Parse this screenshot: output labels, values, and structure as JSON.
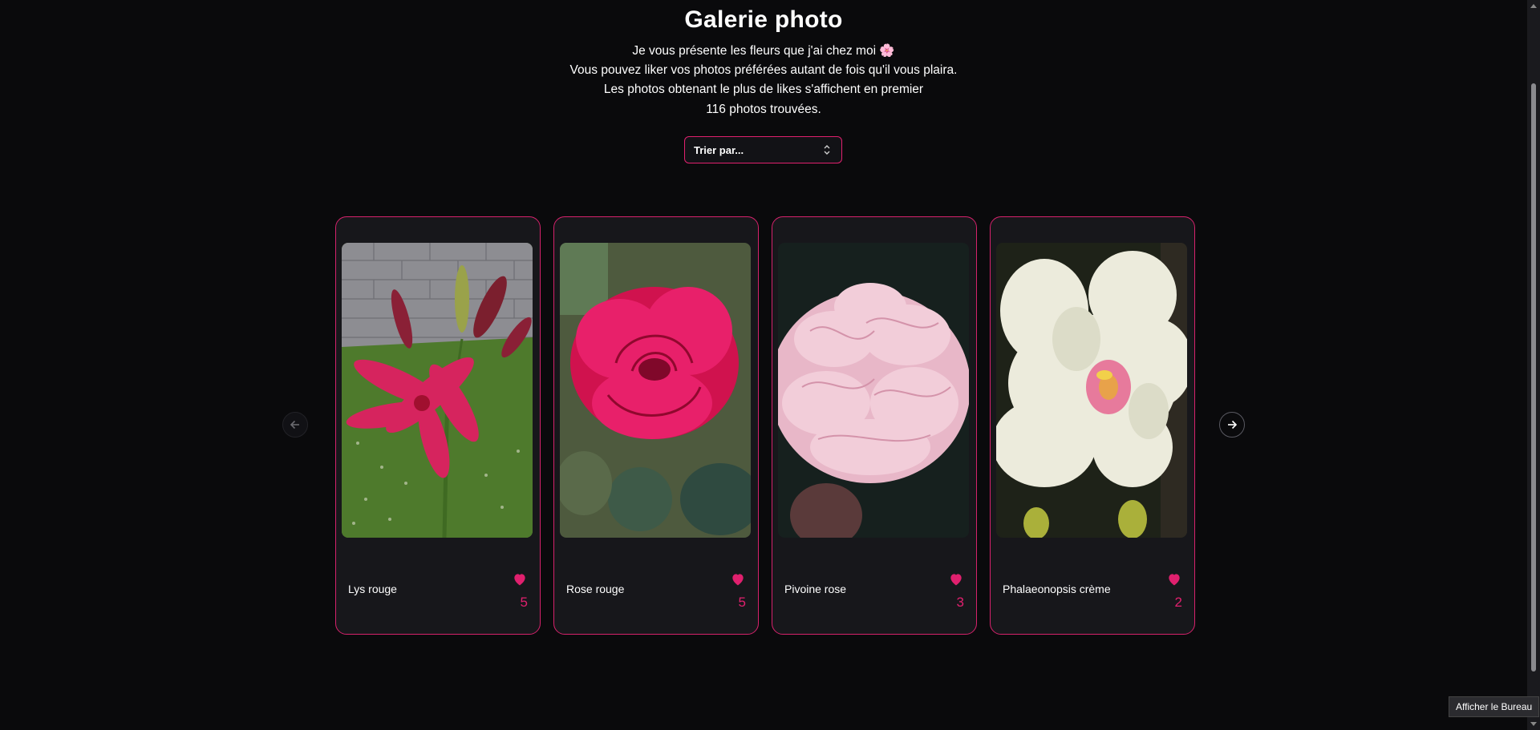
{
  "header": {
    "title": "Galerie photo",
    "intro_lines": [
      "Je vous présente les fleurs que j'ai chez moi 🌸",
      "Vous pouvez liker vos photos préférées autant de fois qu'il vous plaira.",
      "Les photos obtenant le plus de likes s'affichent en premier",
      "116 photos trouvées."
    ]
  },
  "sort": {
    "label": "Trier par...",
    "icon": "chevron-up-down-icon"
  },
  "carousel": {
    "prev_icon": "arrow-left-icon",
    "next_icon": "arrow-right-icon",
    "like_icon": "heart-icon",
    "accent_color": "#e0206e",
    "cards": [
      {
        "name": "Lys rouge",
        "likes": "5"
      },
      {
        "name": "Rose rouge",
        "likes": "5"
      },
      {
        "name": "Pivoine rose",
        "likes": "3"
      },
      {
        "name": "Phalaeonopsis crème",
        "likes": "2"
      }
    ]
  },
  "tooltip": {
    "text": "Afficher le Bureau"
  }
}
